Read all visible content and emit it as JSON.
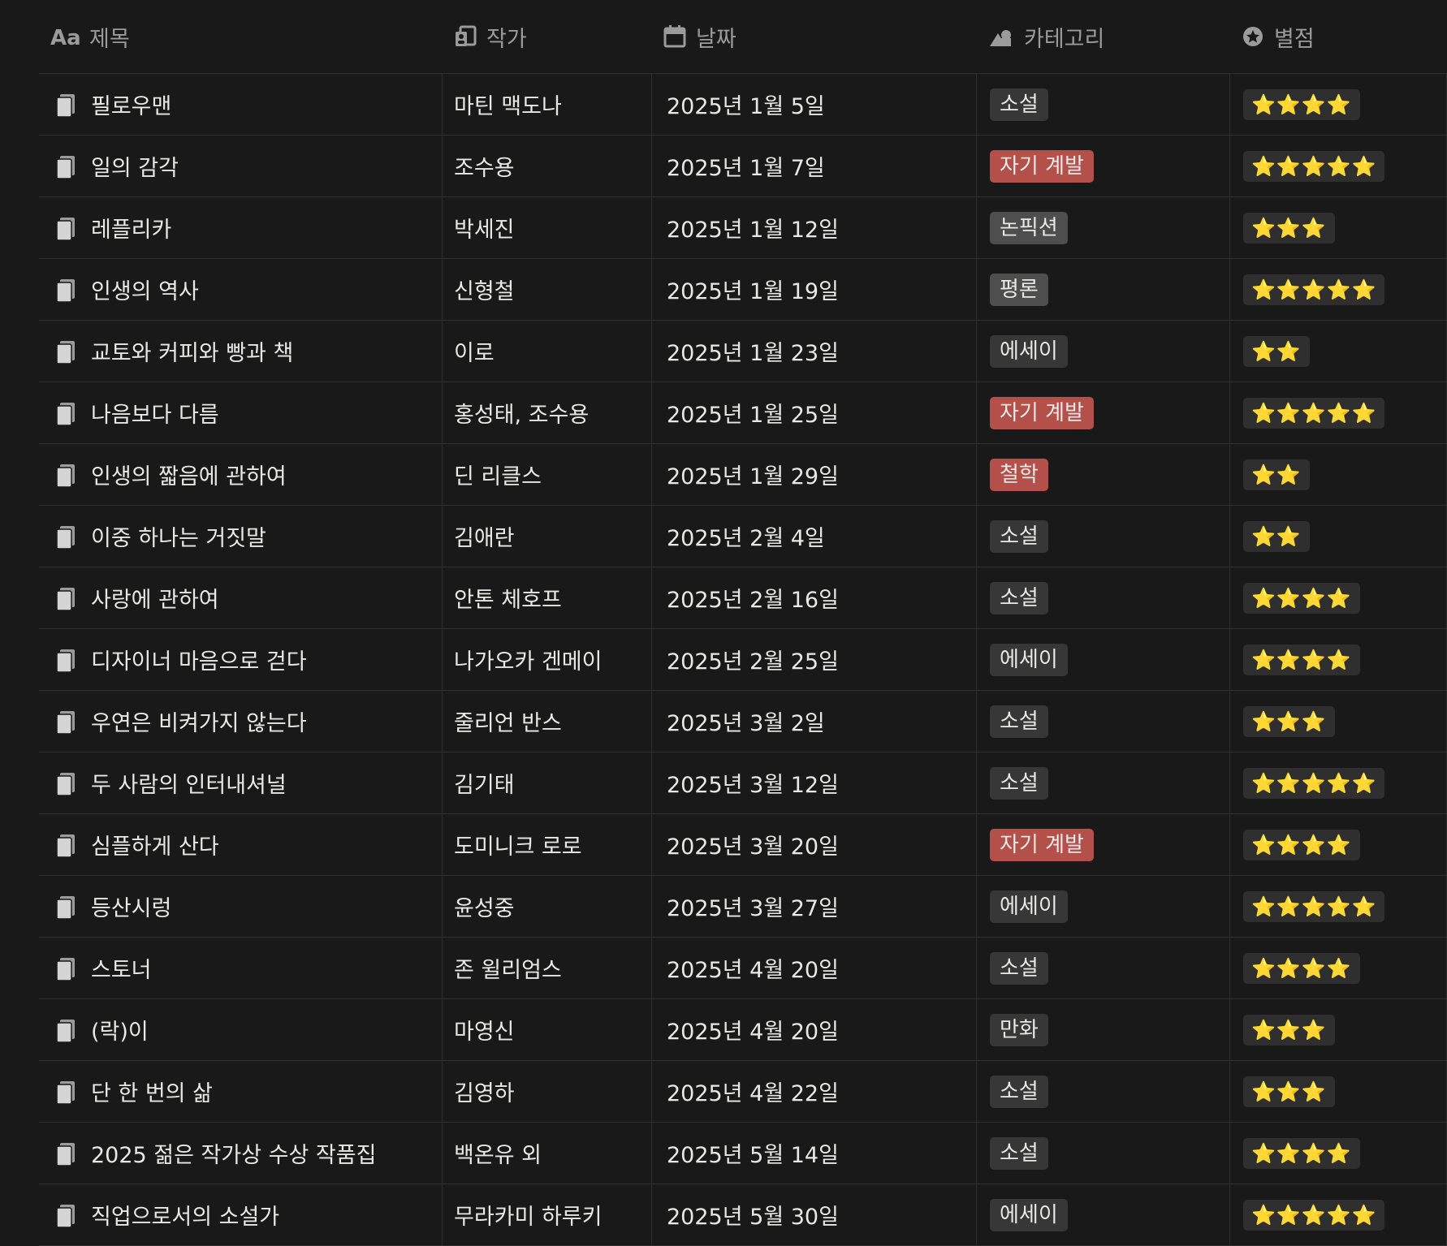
{
  "headers": {
    "title": "제목",
    "author": "작가",
    "date": "날짜",
    "category": "카테고리",
    "rating": "별점"
  },
  "header_icons": {
    "title": "text-aa-icon",
    "author": "person-list-icon",
    "date": "calendar-icon",
    "category": "shapes-icon",
    "rating": "star-circle-icon"
  },
  "category_colors": {
    "소설": "#373737",
    "자기 계발": "#b3504a",
    "논픽션": "#4e4e4e",
    "평론": "#4e4e4e",
    "에세이": "#373737",
    "철학": "#b3504a",
    "만화": "#373737"
  },
  "rows": [
    {
      "title": "필로우맨",
      "author": "마틴 맥도나",
      "date": "2025년 1월 5일",
      "category": "소설",
      "rating": "⭐⭐⭐⭐"
    },
    {
      "title": "일의 감각",
      "author": "조수용",
      "date": "2025년 1월 7일",
      "category": "자기 계발",
      "rating": "⭐⭐⭐⭐⭐"
    },
    {
      "title": "레플리카",
      "author": "박세진",
      "date": "2025년 1월 12일",
      "category": "논픽션",
      "rating": "⭐⭐⭐"
    },
    {
      "title": "인생의 역사",
      "author": "신형철",
      "date": "2025년 1월 19일",
      "category": "평론",
      "rating": "⭐⭐⭐⭐⭐"
    },
    {
      "title": "교토와 커피와 빵과 책",
      "author": "이로",
      "date": "2025년 1월 23일",
      "category": "에세이",
      "rating": "⭐⭐"
    },
    {
      "title": "나음보다 다름",
      "author": "홍성태, 조수용",
      "date": "2025년 1월 25일",
      "category": "자기 계발",
      "rating": "⭐⭐⭐⭐⭐"
    },
    {
      "title": "인생의 짧음에 관하여",
      "author": "딘 리클스",
      "date": "2025년 1월 29일",
      "category": "철학",
      "rating": "⭐⭐"
    },
    {
      "title": "이중 하나는 거짓말",
      "author": "김애란",
      "date": "2025년 2월 4일",
      "category": "소설",
      "rating": "⭐⭐"
    },
    {
      "title": "사랑에 관하여",
      "author": "안톤 체호프",
      "date": "2025년 2월 16일",
      "category": "소설",
      "rating": "⭐⭐⭐⭐"
    },
    {
      "title": "디자이너 마음으로 걷다",
      "author": "나가오카 겐메이",
      "date": "2025년 2월 25일",
      "category": "에세이",
      "rating": "⭐⭐⭐⭐"
    },
    {
      "title": "우연은 비켜가지 않는다",
      "author": "줄리언 반스",
      "date": "2025년 3월 2일",
      "category": "소설",
      "rating": "⭐⭐⭐"
    },
    {
      "title": "두 사람의 인터내셔널",
      "author": "김기태",
      "date": "2025년 3월 12일",
      "category": "소설",
      "rating": "⭐⭐⭐⭐⭐"
    },
    {
      "title": "심플하게 산다",
      "author": "도미니크 로로",
      "date": "2025년 3월 20일",
      "category": "자기 계발",
      "rating": "⭐⭐⭐⭐"
    },
    {
      "title": "등산시렁",
      "author": "윤성중",
      "date": "2025년 3월 27일",
      "category": "에세이",
      "rating": "⭐⭐⭐⭐⭐"
    },
    {
      "title": "스토너",
      "author": "존 윌리엄스",
      "date": "2025년 4월 20일",
      "category": "소설",
      "rating": "⭐⭐⭐⭐"
    },
    {
      "title": "(락)이",
      "author": "마영신",
      "date": "2025년 4월 20일",
      "category": "만화",
      "rating": "⭐⭐⭐"
    },
    {
      "title": "단 한 번의 삶",
      "author": "김영하",
      "date": "2025년 4월 22일",
      "category": "소설",
      "rating": "⭐⭐⭐"
    },
    {
      "title": "2025 젊은 작가상 수상 작품집",
      "author": "백온유 외",
      "date": "2025년 5월 14일",
      "category": "소설",
      "rating": "⭐⭐⭐⭐"
    },
    {
      "title": "직업으로서의 소설가",
      "author": "무라카미 하루키",
      "date": "2025년 5월 30일",
      "category": "에세이",
      "rating": "⭐⭐⭐⭐⭐"
    }
  ]
}
